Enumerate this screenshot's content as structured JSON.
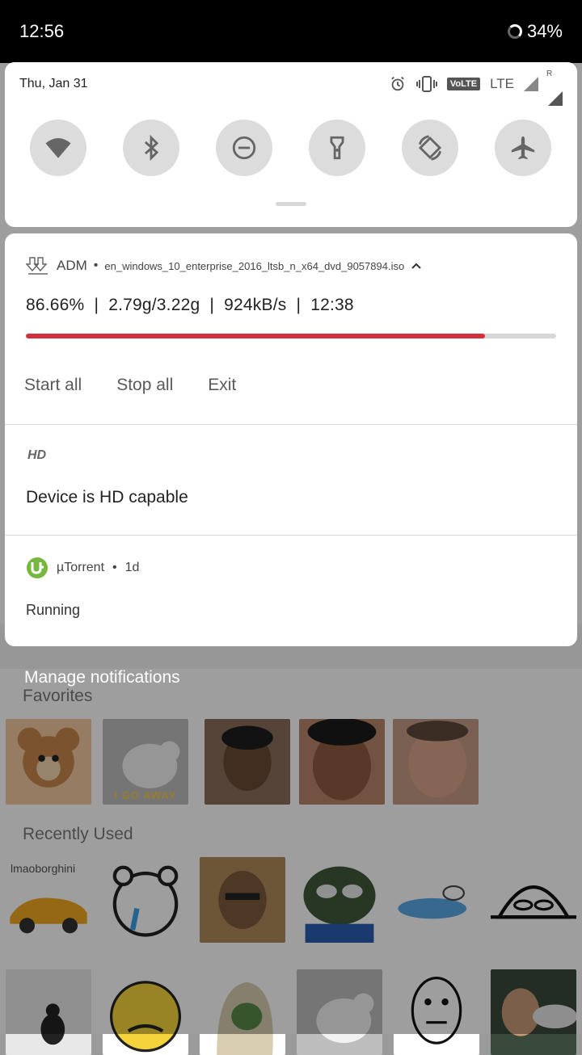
{
  "status_bar": {
    "time": "12:56",
    "battery": "34%"
  },
  "quick_settings": {
    "date": "Thu, Jan 31",
    "network": "LTE",
    "volte": "VoLTE",
    "roaming": "R",
    "tiles": [
      "wifi",
      "bluetooth",
      "do-not-disturb",
      "flashlight",
      "auto-rotate",
      "airplane-mode"
    ]
  },
  "notifications": {
    "adm": {
      "app": "ADM",
      "separator": "•",
      "filename": "en_windows_10_enterprise_2016_ltsb_n_x64_dvd_9057894.iso",
      "progress_text": "86.66%  |  2.79g/3.22g  |  924kB/s  |  12:38",
      "progress": 0.8666,
      "actions": {
        "start": "Start all",
        "stop": "Stop all",
        "exit": "Exit"
      }
    },
    "hd": {
      "label": "HD",
      "text": "Device is HD capable"
    },
    "utorrent": {
      "app": "µTorrent",
      "separator": "•",
      "time": "1d",
      "text": "Running"
    }
  },
  "manage_notifications": "Manage notifications",
  "background": {
    "favorites_title": "Favorites",
    "recent_title": "Recently Used",
    "sticker_caption": "I GO AWAY",
    "sticker_text": "lmaoborghini"
  },
  "colors": {
    "progress": "#d32f3f",
    "utorrent_green": "#76b83f"
  }
}
